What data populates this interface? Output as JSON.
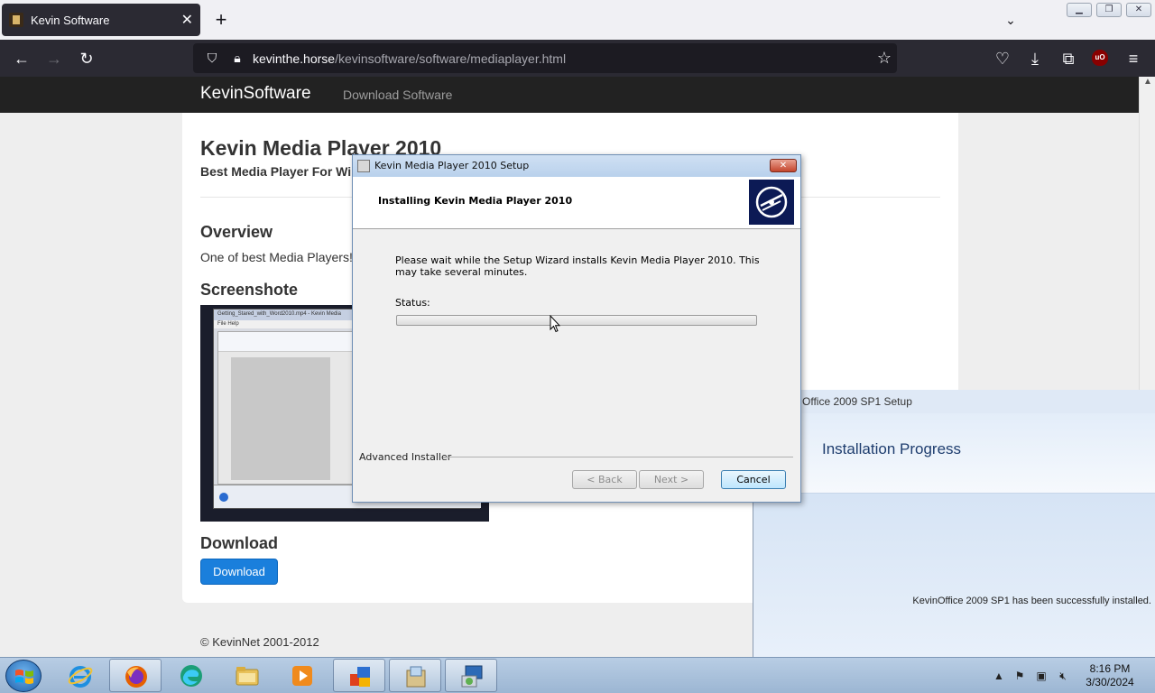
{
  "browser": {
    "tab_title": "Kevin Software",
    "url_host": "kevinthe.horse",
    "url_path": "/kevinsoftware/software/mediaplayer.html"
  },
  "site": {
    "brand": "KevinSoftware",
    "nav_link": "Download Software",
    "title": "Kevin Media Player 2010",
    "subtitle": "Best Media Player For Win",
    "overview_heading": "Overview",
    "overview_text": "One of best Media Players! F",
    "screenshot_heading": "Screenshote",
    "screenshot_window_title": "Getting_Stared_with_Word2010.mp4 - Kevin Media",
    "screenshot_menu": "File    Help",
    "download_heading": "Download",
    "download_button": "Download",
    "footer": "© KevinNet 2001-2012"
  },
  "office_setup": {
    "title": "Office 2009 SP1 Setup",
    "heading": "Installation Progress",
    "message": "KevinOffice 2009 SP1 has been successfully installed."
  },
  "setup_dialog": {
    "title": "Kevin Media Player 2010 Setup",
    "heading": "Installing Kevin Media Player 2010",
    "description": "Please wait while the Setup Wizard installs Kevin Media Player 2010.  This may take several minutes.",
    "status_label": "Status:",
    "progress": 0,
    "brand": "Advanced Installer",
    "back_button": "< Back",
    "next_button": "Next >",
    "cancel_button": "Cancel"
  },
  "taskbar": {
    "time": "8:16 PM",
    "date": "3/30/2024",
    "apps": [
      "internet-explorer",
      "firefox",
      "edge",
      "file-explorer",
      "media-player",
      "office",
      "setup-package",
      "installer"
    ]
  },
  "colors": {
    "browser_dark": "#2b2a33",
    "site_nav": "#222222",
    "download_button": "#1a7fdc",
    "dialog_logo": "#0c1a55"
  }
}
